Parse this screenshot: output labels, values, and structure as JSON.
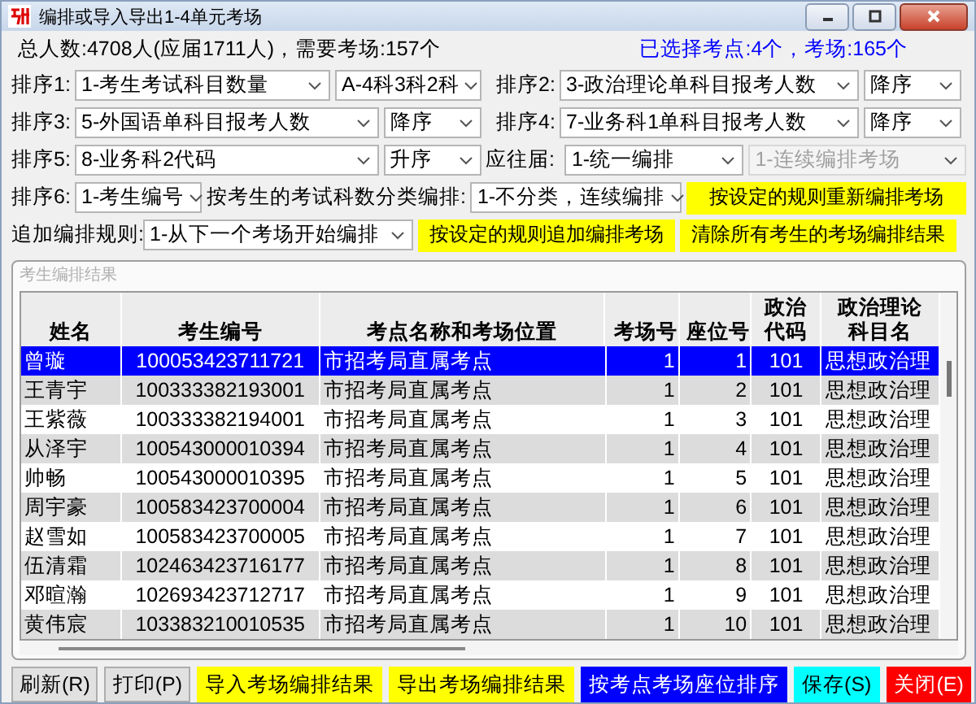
{
  "window": {
    "title": "编排或导入导出1-4单元考场"
  },
  "summary": {
    "totals": "总人数:4708人(应届1711人)，需要考场:157个",
    "selection": "已选择考点:4个，考场:165个"
  },
  "controls": [
    {
      "items": [
        {
          "kind": "label",
          "text": "排序1:"
        },
        {
          "kind": "dropdown",
          "value": "1-考生考试科目数量",
          "disabled": false
        },
        {
          "kind": "dropdown",
          "value": "A-4科3科2科",
          "disabled": false
        },
        {
          "kind": "label",
          "text": "排序2:"
        },
        {
          "kind": "dropdown",
          "value": "3-政治理论单科目报考人数",
          "disabled": false
        },
        {
          "kind": "dropdown",
          "value": "降序",
          "disabled": false
        }
      ]
    },
    {
      "items": [
        {
          "kind": "label",
          "text": "排序3:"
        },
        {
          "kind": "dropdown",
          "value": "5-外国语单科目报考人数",
          "disabled": false
        },
        {
          "kind": "dropdown",
          "value": "降序",
          "disabled": false
        },
        {
          "kind": "label",
          "text": "排序4:"
        },
        {
          "kind": "dropdown",
          "value": "7-业务科1单科目报考人数",
          "disabled": false
        },
        {
          "kind": "dropdown",
          "value": "降序",
          "disabled": false
        }
      ]
    },
    {
      "items": [
        {
          "kind": "label",
          "text": "排序5:"
        },
        {
          "kind": "dropdown",
          "value": "8-业务科2代码",
          "disabled": false
        },
        {
          "kind": "dropdown",
          "value": "升序",
          "disabled": false
        },
        {
          "kind": "label",
          "text": "应往届:"
        },
        {
          "kind": "dropdown",
          "value": "1-统一编排",
          "disabled": false
        },
        {
          "kind": "dropdown",
          "value": "1-连续编排考场",
          "disabled": true
        }
      ]
    },
    {
      "items": [
        {
          "kind": "label",
          "text": "排序6:"
        },
        {
          "kind": "dropdown",
          "value": "1-考生编号",
          "disabled": false
        },
        {
          "kind": "label",
          "text": "按考生的考试科数分类编排:"
        },
        {
          "kind": "dropdown",
          "value": "1-不分类，连续编排",
          "disabled": false
        },
        {
          "kind": "button",
          "text": "按设定的规则重新编排考场",
          "color": "#ffff00"
        }
      ]
    },
    {
      "items": [
        {
          "kind": "label",
          "text": "追加编排规则:"
        },
        {
          "kind": "dropdown",
          "value": "1-从下一个考场开始编排",
          "disabled": false
        },
        {
          "kind": "button",
          "text": "按设定的规则追加编排考场",
          "color": "#ffff00"
        },
        {
          "kind": "button",
          "text": "清除所有考生的考场编排结果",
          "color": "#ffff00"
        }
      ]
    }
  ],
  "results": {
    "title": "考生编排结果",
    "columns": [
      "姓名",
      "考生编号",
      "考点名称和考场位置",
      "考场号",
      "座位号",
      "政治代码",
      "政治理论科目名"
    ],
    "rows": [
      {
        "selected": true,
        "cells": [
          "曾璇",
          "100053423711721",
          "市招考局直属考点",
          "1",
          "1",
          "101",
          "思想政治理"
        ]
      },
      {
        "selected": false,
        "cells": [
          "王青宇",
          "100333382193001",
          "市招考局直属考点",
          "1",
          "2",
          "101",
          "思想政治理"
        ]
      },
      {
        "selected": false,
        "cells": [
          "王紫薇",
          "100333382194001",
          "市招考局直属考点",
          "1",
          "3",
          "101",
          "思想政治理"
        ]
      },
      {
        "selected": false,
        "cells": [
          "从泽宇",
          "100543000010394",
          "市招考局直属考点",
          "1",
          "4",
          "101",
          "思想政治理"
        ]
      },
      {
        "selected": false,
        "cells": [
          "帅畅",
          "100543000010395",
          "市招考局直属考点",
          "1",
          "5",
          "101",
          "思想政治理"
        ]
      },
      {
        "selected": false,
        "cells": [
          "周宇豪",
          "100583423700004",
          "市招考局直属考点",
          "1",
          "6",
          "101",
          "思想政治理"
        ]
      },
      {
        "selected": false,
        "cells": [
          "赵雪如",
          "100583423700005",
          "市招考局直属考点",
          "1",
          "7",
          "101",
          "思想政治理"
        ]
      },
      {
        "selected": false,
        "cells": [
          "伍清霜",
          "102463423716177",
          "市招考局直属考点",
          "1",
          "8",
          "101",
          "思想政治理"
        ]
      },
      {
        "selected": false,
        "cells": [
          "邓暄瀚",
          "102693423712717",
          "市招考局直属考点",
          "1",
          "9",
          "101",
          "思想政治理"
        ]
      },
      {
        "selected": false,
        "cells": [
          "黄伟宸",
          "103383210010535",
          "市招考局直属考点",
          "1",
          "10",
          "101",
          "思想政治理"
        ]
      }
    ]
  },
  "buttons": [
    {
      "text": "刷新(R)"
    },
    {
      "text": "打印(P)"
    },
    {
      "text": "导入考场编排结果",
      "color": "#ffff00"
    },
    {
      "text": "导出考场编排结果",
      "color": "#ffff00"
    },
    {
      "text": "按考点考场座位排序",
      "color": "#0000ff"
    },
    {
      "text": "保存(S)",
      "color": "#00ffff"
    },
    {
      "text": "关闭(E)",
      "color": "#ff0000"
    }
  ]
}
